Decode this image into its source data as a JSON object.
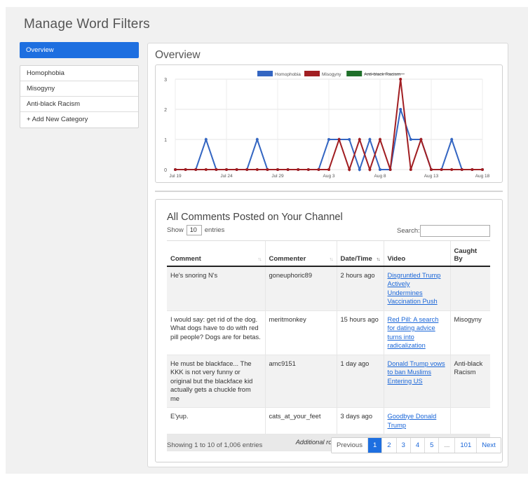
{
  "page": {
    "title": "Manage Word Filters"
  },
  "sidebar": {
    "active": "Overview",
    "items": [
      "Homophobia",
      "Misogyny",
      "Anti-black Racism",
      "+ Add New Category"
    ]
  },
  "main": {
    "title": "Overview"
  },
  "chart_data": {
    "type": "line",
    "x": [
      "Jul 19",
      "Jul 20",
      "Jul 21",
      "Jul 22",
      "Jul 23",
      "Jul 24",
      "Jul 25",
      "Jul 26",
      "Jul 27",
      "Jul 28",
      "Jul 29",
      "Jul 30",
      "Jul 31",
      "Aug 1",
      "Aug 2",
      "Aug 3",
      "Aug 4",
      "Aug 5",
      "Aug 6",
      "Aug 7",
      "Aug 8",
      "Aug 9",
      "Aug 10",
      "Aug 11",
      "Aug 12",
      "Aug 13",
      "Aug 14",
      "Aug 15",
      "Aug 16",
      "Aug 17",
      "Aug 18"
    ],
    "x_tick_labels": [
      "Jul 19",
      "Jul 24",
      "Jul 29",
      "Aug 3",
      "Aug 8",
      "Aug 13",
      "Aug 18"
    ],
    "y_tick_labels": [
      "0",
      "1",
      "2",
      "3"
    ],
    "ylim": [
      0,
      3
    ],
    "legend_position": "top",
    "series": [
      {
        "name": "Homophobia",
        "color": "#3466c2",
        "values": [
          0,
          0,
          0,
          1,
          0,
          0,
          0,
          0,
          1,
          0,
          0,
          0,
          0,
          0,
          0,
          1,
          1,
          1,
          0,
          1,
          0,
          0,
          2,
          1,
          1,
          0,
          0,
          1,
          0,
          0,
          0
        ]
      },
      {
        "name": "Misogyny",
        "color": "#a11e22",
        "values": [
          0,
          0,
          0,
          0,
          0,
          0,
          0,
          0,
          0,
          0,
          0,
          0,
          0,
          0,
          0,
          0,
          1,
          0,
          1,
          0,
          1,
          0,
          3,
          0,
          1,
          0,
          0,
          0,
          0,
          0,
          0
        ]
      },
      {
        "name": "Anti-black Racism",
        "color": "#1f6f2a",
        "hidden": true,
        "values": []
      }
    ]
  },
  "comments": {
    "title": "All Comments Posted on Your Channel",
    "show_label": "Show",
    "entries_value": "10",
    "entries_label": "entries",
    "search_label": "Search:",
    "search_value": "",
    "columns": [
      "Comment",
      "Commenter",
      "Date/Time",
      "Video",
      "Caught By"
    ],
    "rows": [
      {
        "comment": "He's snoring N's",
        "commenter": "goneuphoric89",
        "time": "2 hours ago",
        "video": "Disgruntled Trump Actively Undermines Vaccination Push",
        "caught": ""
      },
      {
        "comment": "I would say: get rid of the dog. What dogs have to do with red pill people? Dogs are for betas.",
        "commenter": "meritmonkey",
        "time": "15 hours ago",
        "video": "Red Pill: A search for dating advice turns into radicalization",
        "caught": "Misogyny"
      },
      {
        "comment": "He must be blackface... The KKK is not very funny or original but the blackface kid actually gets a chuckle from me",
        "commenter": "amc9151",
        "time": "1 day ago",
        "video": "Donald Trump vows to ban Muslims Entering US",
        "caught": "Anti-black Racism"
      },
      {
        "comment": "E'yup.",
        "commenter": "cats_at_your_feet",
        "time": "3 days ago",
        "video": "Goodbye Donald Trump",
        "caught": ""
      }
    ],
    "hidden_note": "Additional rows hidden",
    "info": "Showing 1 to 10 of 1,006 entries",
    "pagination": [
      "Previous",
      "1",
      "2",
      "3",
      "4",
      "5",
      "...",
      "101",
      "Next"
    ],
    "active_page": "1"
  }
}
